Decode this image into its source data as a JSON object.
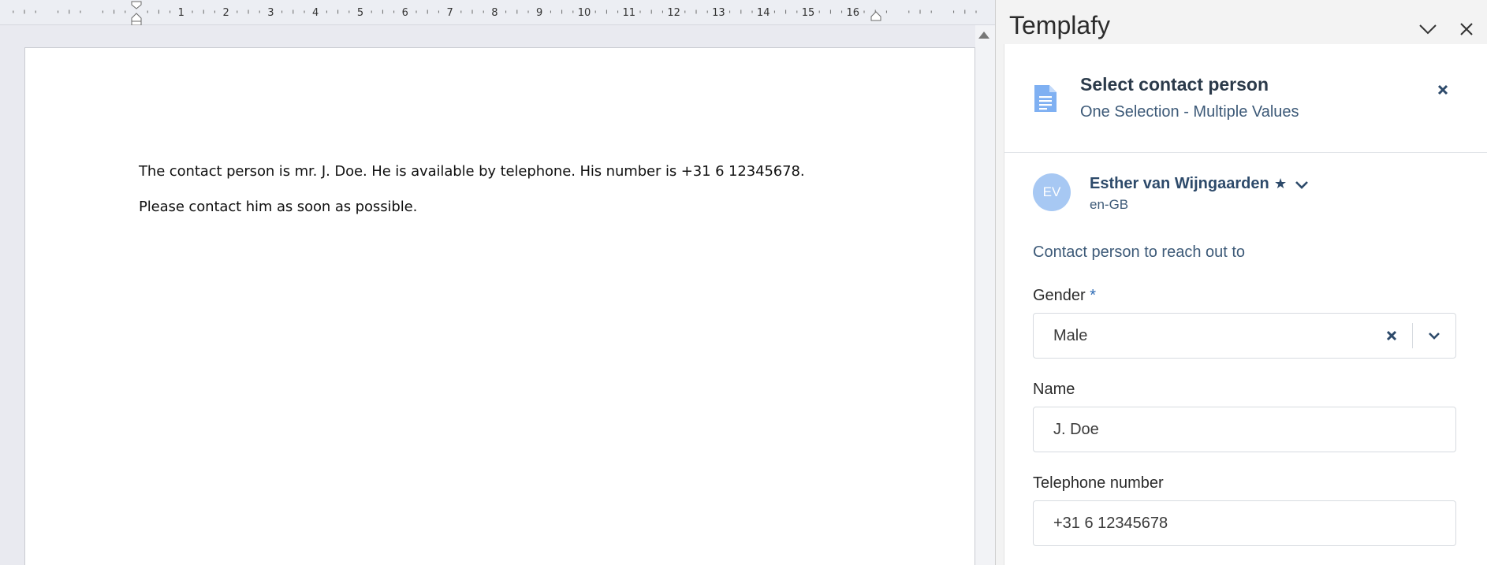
{
  "document": {
    "ruler_numbers": [
      "1",
      "2",
      "3",
      "4",
      "5",
      "6",
      "7",
      "8",
      "9",
      "10",
      "11",
      "12",
      "13",
      "14",
      "15",
      "16"
    ],
    "lines": [
      "The contact person is mr. J. Doe. He is available by telephone. His number is +31 6 12345678.",
      "Please contact him as soon as possible."
    ]
  },
  "pane": {
    "title": "Templafy",
    "menu_icon": "chevron-down-icon",
    "close_icon": "close-icon",
    "card": {
      "icon": "document-icon",
      "title": "Select contact person",
      "subtitle": "One Selection - Multiple Values",
      "close_icon": "close-icon"
    },
    "user": {
      "initials": "EV",
      "name": "Esther van Wijngaarden",
      "star": "★",
      "locale": "en-GB"
    },
    "description": "Contact person to reach out to",
    "fields": {
      "gender": {
        "label": "Gender",
        "required_mark": "*",
        "value": "Male"
      },
      "name": {
        "label": "Name",
        "value": "J. Doe"
      },
      "telephone": {
        "label": "Telephone number",
        "value": "+31 6 12345678"
      }
    }
  },
  "colors": {
    "accent": "#2d6bb5",
    "avatar": "#a7c8f3",
    "doc_icon": "#7fb0f2",
    "heading_text": "#2d4a6a"
  }
}
